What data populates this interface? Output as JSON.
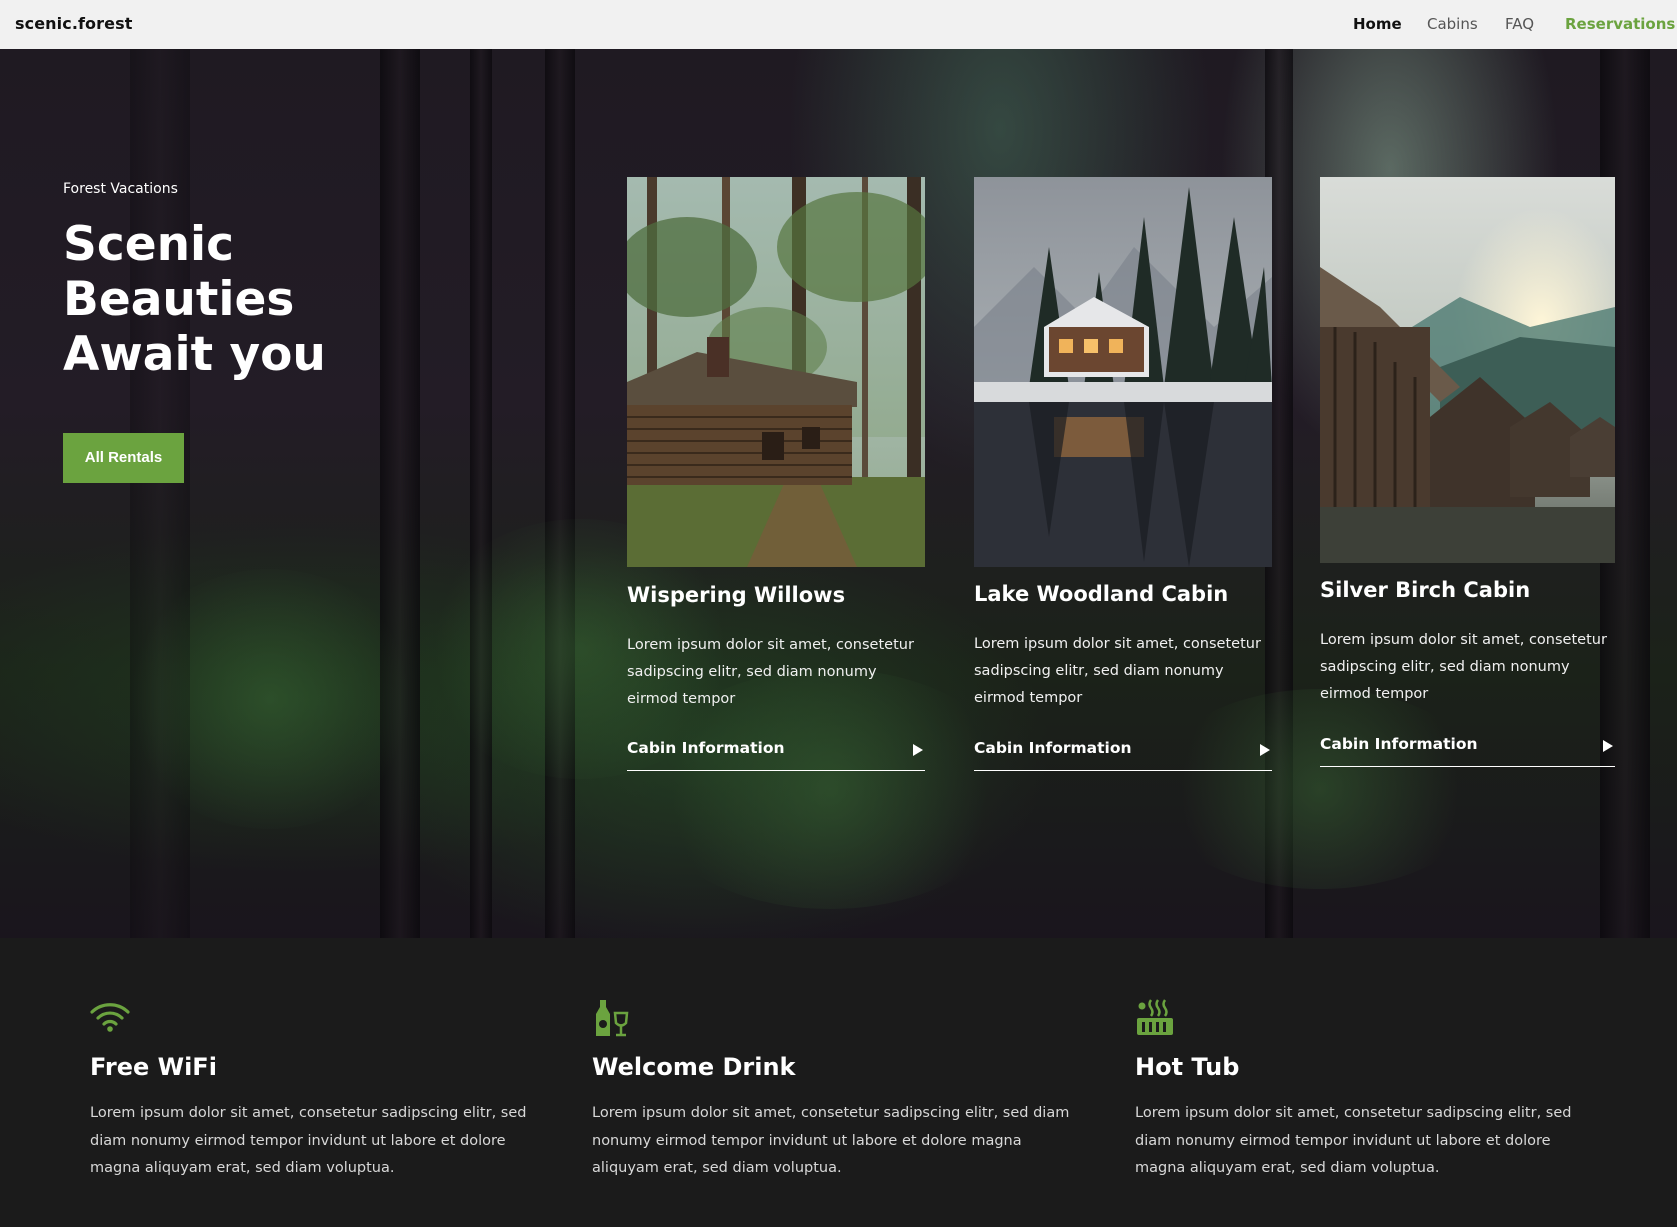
{
  "nav": {
    "brand": "scenic.forest",
    "links": [
      "Home",
      "Cabins",
      "FAQ",
      "Reservations"
    ]
  },
  "hero": {
    "eyebrow": "Forest Vacations",
    "title": "Scenic Beauties Await you",
    "cta": "All Rentals"
  },
  "cabins": [
    {
      "title": "Wispering Willows",
      "text": "Lorem ipsum dolor sit amet, consetetur sadipscing elitr, sed diam nonumy eirmod tempor",
      "link": "Cabin Information"
    },
    {
      "title": "Lake Woodland Cabin",
      "text": "Lorem ipsum dolor sit amet, consetetur sadipscing elitr, sed diam nonumy eirmod tempor",
      "link": "Cabin Information"
    },
    {
      "title": "Silver Birch Cabin",
      "text": "Lorem ipsum dolor sit amet, consetetur sadipscing elitr, sed diam nonumy eirmod tempor",
      "link": "Cabin Information"
    }
  ],
  "features": [
    {
      "icon": "wifi-icon",
      "title": "Free WiFi",
      "text": "Lorem ipsum dolor sit amet, consetetur sadipscing elitr, sed diam nonumy eirmod tempor invidunt ut labore et dolore magna aliquyam erat, sed diam voluptua."
    },
    {
      "icon": "wine-bottle-glass-icon",
      "title": "Welcome Drink",
      "text": "Lorem ipsum dolor sit amet, consetetur sadipscing elitr, sed diam nonumy eirmod tempor invidunt ut labore et dolore magna aliquyam erat, sed diam voluptua."
    },
    {
      "icon": "hot-tub-icon",
      "title": "Hot Tub",
      "text": "Lorem ipsum dolor sit amet, consetetur sadipscing elitr, sed diam nonumy eirmod tempor invidunt ut labore et dolore magna aliquyam erat, sed diam voluptua."
    }
  ],
  "colors": {
    "accent": "#6ba33f",
    "nav_bg": "#f1f1f1",
    "footer_bg": "#1b1b1b"
  }
}
